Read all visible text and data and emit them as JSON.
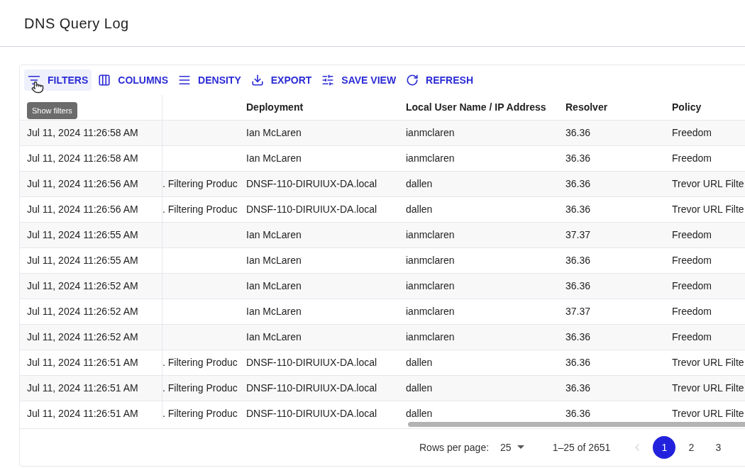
{
  "page": {
    "title": "DNS Query Log"
  },
  "toolbar": [
    {
      "kind": "filters",
      "label": "FILTERS",
      "highlighted": true
    },
    {
      "kind": "columns",
      "label": "COLUMNS",
      "highlighted": false
    },
    {
      "kind": "density",
      "label": "DENSITY",
      "highlighted": false
    },
    {
      "kind": "export",
      "label": "EXPORT",
      "highlighted": false
    },
    {
      "kind": "saveview",
      "label": "SAVE VIEW",
      "highlighted": false
    },
    {
      "kind": "refresh",
      "label": "REFRESH",
      "highlighted": false
    }
  ],
  "tooltip": "Show filters",
  "table": {
    "columns": [
      "",
      "",
      "Deployment",
      "Local User Name / IP Address",
      "Resolver",
      "Policy"
    ],
    "rows": [
      [
        "Jul 11, 2024 11:26:58 AM",
        "",
        "Ian McLaren",
        "ianmclaren",
        "36.36",
        "Freedom"
      ],
      [
        "Jul 11, 2024 11:26:58 AM",
        "",
        "Ian McLaren",
        "ianmclaren",
        "36.36",
        "Freedom"
      ],
      [
        "Jul 11, 2024 11:26:56 AM",
        ". Filtering Produc",
        "DNSF-110-DIRUIUX-DA.local",
        "dallen",
        "36.36",
        "Trevor URL Filte"
      ],
      [
        "Jul 11, 2024 11:26:56 AM",
        ". Filtering Produc",
        "DNSF-110-DIRUIUX-DA.local",
        "dallen",
        "36.36",
        "Trevor URL Filte"
      ],
      [
        "Jul 11, 2024 11:26:55 AM",
        "",
        "Ian McLaren",
        "ianmclaren",
        "37.37",
        "Freedom"
      ],
      [
        "Jul 11, 2024 11:26:55 AM",
        "",
        "Ian McLaren",
        "ianmclaren",
        "36.36",
        "Freedom"
      ],
      [
        "Jul 11, 2024 11:26:52 AM",
        "",
        "Ian McLaren",
        "ianmclaren",
        "36.36",
        "Freedom"
      ],
      [
        "Jul 11, 2024 11:26:52 AM",
        "",
        "Ian McLaren",
        "ianmclaren",
        "37.37",
        "Freedom"
      ],
      [
        "Jul 11, 2024 11:26:52 AM",
        "",
        "Ian McLaren",
        "ianmclaren",
        "36.36",
        "Freedom"
      ],
      [
        "Jul 11, 2024 11:26:51 AM",
        ". Filtering Produc",
        "DNSF-110-DIRUIUX-DA.local",
        "dallen",
        "36.36",
        "Trevor URL Filte"
      ],
      [
        "Jul 11, 2024 11:26:51 AM",
        ". Filtering Produc",
        "DNSF-110-DIRUIUX-DA.local",
        "dallen",
        "36.36",
        "Trevor URL Filte"
      ],
      [
        "Jul 11, 2024 11:26:51 AM",
        ". Filtering Produc",
        "DNSF-110-DIRUIUX-DA.local",
        "dallen",
        "36.36",
        "Trevor URL Filte"
      ]
    ]
  },
  "footer": {
    "rows_label": "Rows per page:",
    "rows_value": "25",
    "range": "1–25 of 2651",
    "pages": [
      {
        "label": "1",
        "selected": true
      },
      {
        "label": "2",
        "selected": false
      },
      {
        "label": "3",
        "selected": false
      }
    ]
  }
}
